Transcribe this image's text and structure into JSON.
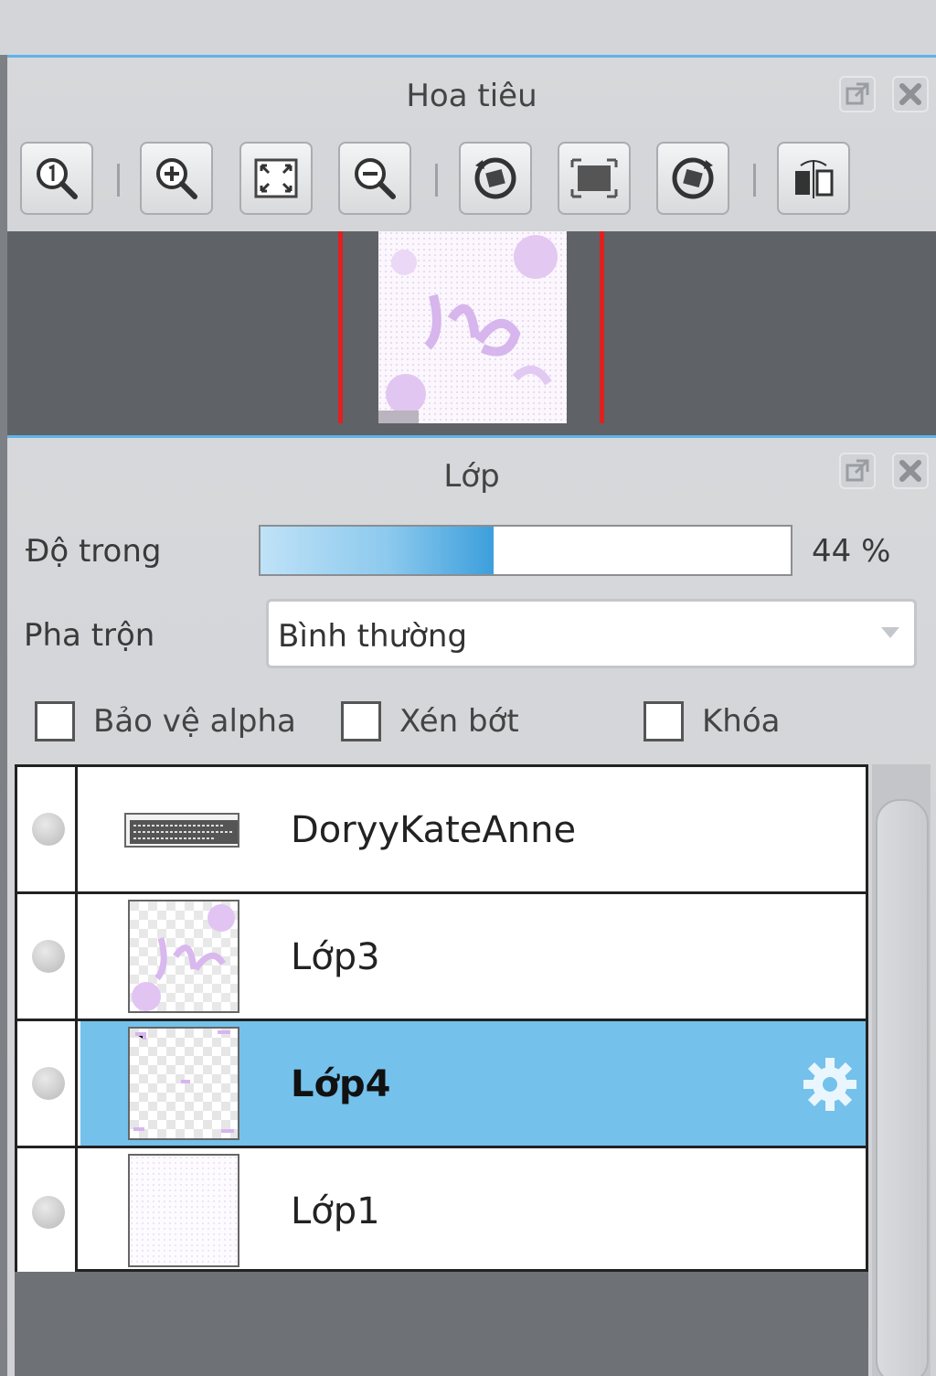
{
  "navigator": {
    "title": "Hoa tiêu",
    "tools": [
      {
        "icon": "zoom-actual-icon"
      },
      {
        "icon": "zoom-in-icon"
      },
      {
        "icon": "fit-window-icon"
      },
      {
        "icon": "zoom-out-icon"
      },
      {
        "icon": "rotate-left-icon"
      },
      {
        "icon": "reset-view-icon"
      },
      {
        "icon": "rotate-right-icon"
      },
      {
        "icon": "flip-horizontal-icon"
      }
    ]
  },
  "layers_panel": {
    "title": "Lớp",
    "opacity_label": "Độ trong",
    "opacity_value": "44 %",
    "opacity_fraction": 0.44,
    "blend_label": "Pha trộn",
    "blend_value": "Bình thường",
    "checkboxes": [
      {
        "label": "Bảo vệ alpha",
        "checked": false
      },
      {
        "label": "Xén bớt",
        "checked": false
      },
      {
        "label": "Khóa",
        "checked": false
      }
    ],
    "layers": [
      {
        "name": "DoryyKateAnne",
        "selected": false
      },
      {
        "name": "Lớp3",
        "selected": false
      },
      {
        "name": "Lớp4",
        "selected": true
      },
      {
        "name": "Lớp1",
        "selected": false
      }
    ]
  },
  "colors": {
    "accent": "#5fb3e6",
    "selected_row": "#74c1ec",
    "viewport_border": "#e02020"
  }
}
